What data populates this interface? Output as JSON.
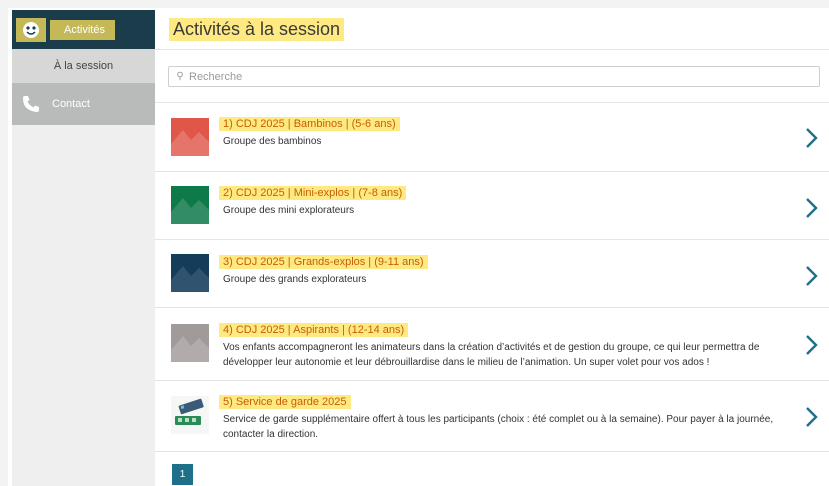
{
  "sidebar": {
    "active_label": "Activités",
    "sub_label": "À la session",
    "contact_label": "Contact"
  },
  "main": {
    "title": "Activités à la session",
    "search_placeholder": "Recherche",
    "items": [
      {
        "title": "1) CDJ 2025 | Bambinos | (5-6 ans)",
        "desc": "Groupe des bambinos",
        "color": "#e0574a"
      },
      {
        "title": "2) CDJ 2025 | Mini-explos | (7-8 ans)",
        "desc": "Groupe des mini explorateurs",
        "color": "#0f7a49"
      },
      {
        "title": "3) CDJ 2025 | Grands-explos | (9-11 ans)",
        "desc": "Groupe des grands explorateurs",
        "color": "#143d5c"
      },
      {
        "title": "4) CDJ 2025 | Aspirants | (12-14 ans)",
        "desc": "Vos enfants accompagneront les animateurs dans la création d’activités et de gestion du groupe, ce qui leur permettra de développer leur autonomie et leur débrouillardise dans le milieu de l’animation. Un super volet pour vos ados !",
        "color": "#a09a99"
      },
      {
        "title": "5) Service de garde 2025",
        "desc": "Service de garde supplémentaire offert à tous les participants (choix : été complet ou à la semaine). Pour payer à la journée, contacter la direction.",
        "color": "#2a8b59"
      }
    ],
    "page_number": "1"
  },
  "colors": {
    "sidebar_active": "#1b3d4b",
    "accent_title": "#c65f00",
    "chevron": "#1e6f8a",
    "highlight": "#ffe15a"
  }
}
